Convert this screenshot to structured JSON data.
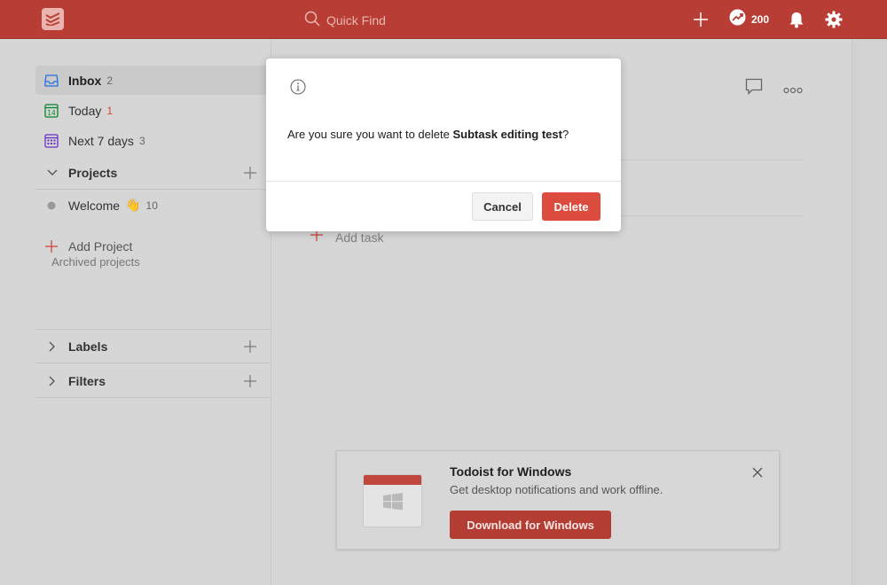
{
  "header": {
    "search_placeholder": "Quick Find",
    "karma": "200",
    "icons": [
      "todoist-logo-icon",
      "search-icon",
      "add-icon",
      "karma-icon",
      "bell-icon",
      "gear-icon"
    ],
    "accent": "#b83e35"
  },
  "sidebar": {
    "inbox": {
      "label": "Inbox",
      "count": "2"
    },
    "today": {
      "label": "Today",
      "count": "1",
      "icon_day": "14"
    },
    "next7": {
      "label": "Next 7 days",
      "count": "3"
    },
    "projects": {
      "label": "Projects"
    },
    "welcome": {
      "label": "Welcome",
      "count": "10",
      "emoji": "👋"
    },
    "add_project": "Add Project",
    "archived": "Archived projects",
    "labels": "Labels",
    "filters": "Filters"
  },
  "main": {
    "add_task": "Add task"
  },
  "promo": {
    "title": "Todoist for Windows",
    "subtitle": "Get desktop notifications and work offline.",
    "button": "Download for Windows"
  },
  "dialog": {
    "message_prefix": "Are you sure you want to delete ",
    "task_name": "Subtask editing test",
    "message_suffix": "?",
    "cancel": "Cancel",
    "delete": "Delete",
    "delete_color": "#db4c3f"
  }
}
